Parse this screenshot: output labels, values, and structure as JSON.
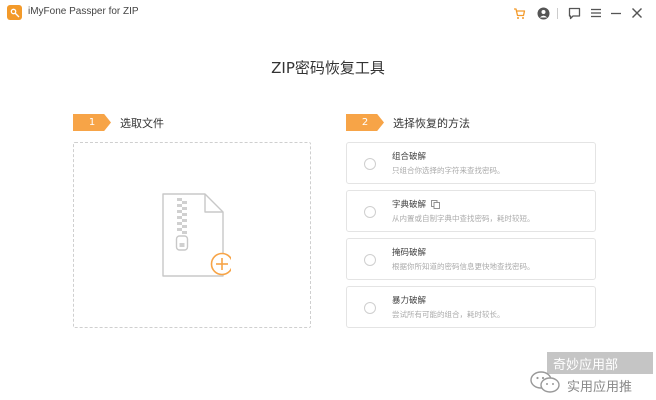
{
  "window": {
    "title": "iMyFone Passper for ZIP",
    "icons": [
      "cart-icon",
      "user-icon",
      "feedback-icon",
      "menu-icon",
      "minimize-icon",
      "close-icon"
    ]
  },
  "main": {
    "title": "ZIP密码恢复工具"
  },
  "step1": {
    "number": "1",
    "label": "选取文件"
  },
  "step2": {
    "number": "2",
    "label": "选择恢复的方法"
  },
  "methods": [
    {
      "name": "组合破解",
      "description": "只组合你选择的字符来查找密码。"
    },
    {
      "name": "字典破解",
      "description": "从内置或自制字典中查找密码，耗时较短。"
    },
    {
      "name": "掩码破解",
      "description": "根据你所知道的密码信息更快地查找密码。"
    },
    {
      "name": "暴力破解",
      "description": "尝试所有可能的组合，耗时较长。"
    }
  ],
  "watermark": {
    "line1": "奇妙应用部",
    "line2": "实用应用推"
  },
  "colors": {
    "accent": "#f7a447",
    "border": "#e4e4e4",
    "muted_text": "#aaaaaa"
  }
}
